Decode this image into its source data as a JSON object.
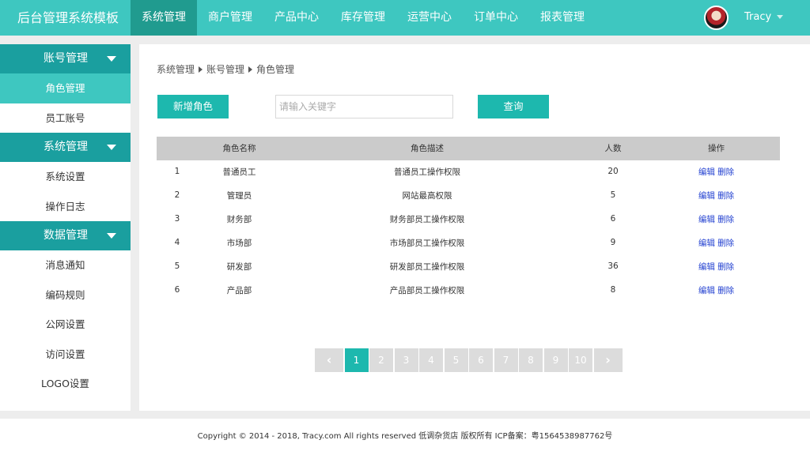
{
  "header": {
    "brand": "后台管理系统模板",
    "nav": [
      "系统管理",
      "商户管理",
      "产品中心",
      "库存管理",
      "运营中心",
      "订单中心",
      "报表管理"
    ],
    "active_nav": "系统管理",
    "username": "Tracy"
  },
  "sidebar": {
    "groups": [
      {
        "label": "账号管理",
        "items": [
          "角色管理",
          "员工账号"
        ]
      },
      {
        "label": "系统管理",
        "items": [
          "系统设置",
          "操作日志"
        ]
      },
      {
        "label": "数据管理",
        "items": [
          "消息通知",
          "编码规则",
          "公网设置",
          "访问设置",
          "LOGO设置"
        ]
      }
    ],
    "active_item": "角色管理"
  },
  "breadcrumb": [
    "系统管理",
    "账号管理",
    "角色管理"
  ],
  "toolbar": {
    "add_label": "新增角色",
    "search_placeholder": "请输入关键字",
    "search_value": "",
    "query_label": "查询"
  },
  "table": {
    "headers": [
      "",
      "角色名称",
      "角色描述",
      "人数",
      "操作"
    ],
    "rows": [
      {
        "idx": "1",
        "name": "普通员工",
        "desc": "普通员工操作权限",
        "count": "20"
      },
      {
        "idx": "2",
        "name": "管理员",
        "desc": "网站最高权限",
        "count": "5"
      },
      {
        "idx": "3",
        "name": "财务部",
        "desc": "财务部员工操作权限",
        "count": "6"
      },
      {
        "idx": "4",
        "name": "市场部",
        "desc": "市场部员工操作权限",
        "count": "9"
      },
      {
        "idx": "5",
        "name": "研发部",
        "desc": "研发部员工操作权限",
        "count": "36"
      },
      {
        "idx": "6",
        "name": "产品部",
        "desc": "产品部员工操作权限",
        "count": "8"
      }
    ],
    "edit_label": "编辑",
    "delete_label": "删除"
  },
  "pagination": {
    "prev": "‹",
    "next": "›",
    "pages": [
      "1",
      "2",
      "3",
      "4",
      "5",
      "6",
      "7",
      "8",
      "9",
      "10"
    ],
    "current": "1"
  },
  "footer": {
    "text": "Copyright © 2014 - 2018, Tracy.com All rights reserved 低调杂货店 版权所有 ICP备案：粤1564538987762号"
  },
  "colors": {
    "topbar": "#3ec7c0",
    "nav_active": "#209b8f",
    "sidebar_group": "#1a9f9f",
    "primary_button": "#1db8ae",
    "link": "#2240d0"
  }
}
